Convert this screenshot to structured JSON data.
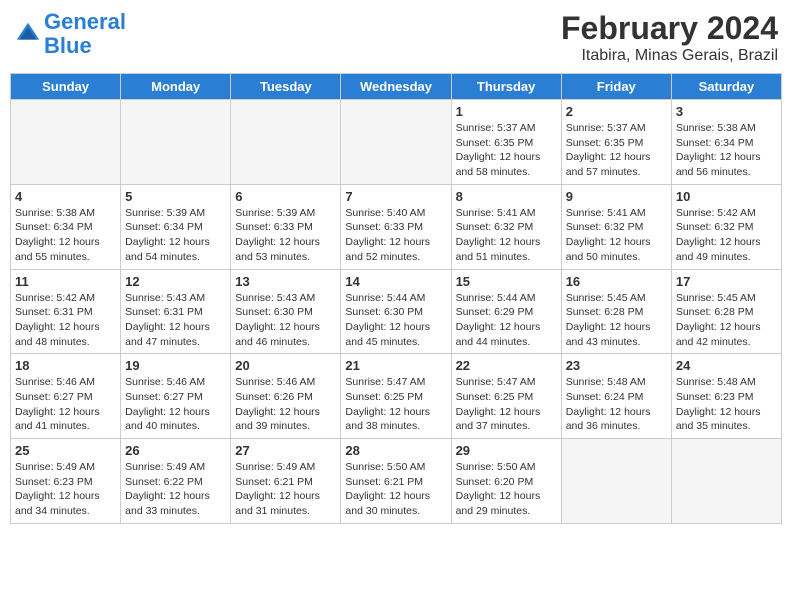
{
  "header": {
    "logo_line1": "General",
    "logo_line2": "Blue",
    "month_year": "February 2024",
    "location": "Itabira, Minas Gerais, Brazil"
  },
  "days_of_week": [
    "Sunday",
    "Monday",
    "Tuesday",
    "Wednesday",
    "Thursday",
    "Friday",
    "Saturday"
  ],
  "weeks": [
    [
      {
        "day": "",
        "empty": true
      },
      {
        "day": "",
        "empty": true
      },
      {
        "day": "",
        "empty": true
      },
      {
        "day": "",
        "empty": true
      },
      {
        "day": "1",
        "sunrise": "5:37 AM",
        "sunset": "6:35 PM",
        "daylight": "12 hours and 58 minutes."
      },
      {
        "day": "2",
        "sunrise": "5:37 AM",
        "sunset": "6:35 PM",
        "daylight": "12 hours and 57 minutes."
      },
      {
        "day": "3",
        "sunrise": "5:38 AM",
        "sunset": "6:34 PM",
        "daylight": "12 hours and 56 minutes."
      }
    ],
    [
      {
        "day": "4",
        "sunrise": "5:38 AM",
        "sunset": "6:34 PM",
        "daylight": "12 hours and 55 minutes."
      },
      {
        "day": "5",
        "sunrise": "5:39 AM",
        "sunset": "6:34 PM",
        "daylight": "12 hours and 54 minutes."
      },
      {
        "day": "6",
        "sunrise": "5:39 AM",
        "sunset": "6:33 PM",
        "daylight": "12 hours and 53 minutes."
      },
      {
        "day": "7",
        "sunrise": "5:40 AM",
        "sunset": "6:33 PM",
        "daylight": "12 hours and 52 minutes."
      },
      {
        "day": "8",
        "sunrise": "5:41 AM",
        "sunset": "6:32 PM",
        "daylight": "12 hours and 51 minutes."
      },
      {
        "day": "9",
        "sunrise": "5:41 AM",
        "sunset": "6:32 PM",
        "daylight": "12 hours and 50 minutes."
      },
      {
        "day": "10",
        "sunrise": "5:42 AM",
        "sunset": "6:32 PM",
        "daylight": "12 hours and 49 minutes."
      }
    ],
    [
      {
        "day": "11",
        "sunrise": "5:42 AM",
        "sunset": "6:31 PM",
        "daylight": "12 hours and 48 minutes."
      },
      {
        "day": "12",
        "sunrise": "5:43 AM",
        "sunset": "6:31 PM",
        "daylight": "12 hours and 47 minutes."
      },
      {
        "day": "13",
        "sunrise": "5:43 AM",
        "sunset": "6:30 PM",
        "daylight": "12 hours and 46 minutes."
      },
      {
        "day": "14",
        "sunrise": "5:44 AM",
        "sunset": "6:30 PM",
        "daylight": "12 hours and 45 minutes."
      },
      {
        "day": "15",
        "sunrise": "5:44 AM",
        "sunset": "6:29 PM",
        "daylight": "12 hours and 44 minutes."
      },
      {
        "day": "16",
        "sunrise": "5:45 AM",
        "sunset": "6:28 PM",
        "daylight": "12 hours and 43 minutes."
      },
      {
        "day": "17",
        "sunrise": "5:45 AM",
        "sunset": "6:28 PM",
        "daylight": "12 hours and 42 minutes."
      }
    ],
    [
      {
        "day": "18",
        "sunrise": "5:46 AM",
        "sunset": "6:27 PM",
        "daylight": "12 hours and 41 minutes."
      },
      {
        "day": "19",
        "sunrise": "5:46 AM",
        "sunset": "6:27 PM",
        "daylight": "12 hours and 40 minutes."
      },
      {
        "day": "20",
        "sunrise": "5:46 AM",
        "sunset": "6:26 PM",
        "daylight": "12 hours and 39 minutes."
      },
      {
        "day": "21",
        "sunrise": "5:47 AM",
        "sunset": "6:25 PM",
        "daylight": "12 hours and 38 minutes."
      },
      {
        "day": "22",
        "sunrise": "5:47 AM",
        "sunset": "6:25 PM",
        "daylight": "12 hours and 37 minutes."
      },
      {
        "day": "23",
        "sunrise": "5:48 AM",
        "sunset": "6:24 PM",
        "daylight": "12 hours and 36 minutes."
      },
      {
        "day": "24",
        "sunrise": "5:48 AM",
        "sunset": "6:23 PM",
        "daylight": "12 hours and 35 minutes."
      }
    ],
    [
      {
        "day": "25",
        "sunrise": "5:49 AM",
        "sunset": "6:23 PM",
        "daylight": "12 hours and 34 minutes."
      },
      {
        "day": "26",
        "sunrise": "5:49 AM",
        "sunset": "6:22 PM",
        "daylight": "12 hours and 33 minutes."
      },
      {
        "day": "27",
        "sunrise": "5:49 AM",
        "sunset": "6:21 PM",
        "daylight": "12 hours and 31 minutes."
      },
      {
        "day": "28",
        "sunrise": "5:50 AM",
        "sunset": "6:21 PM",
        "daylight": "12 hours and 30 minutes."
      },
      {
        "day": "29",
        "sunrise": "5:50 AM",
        "sunset": "6:20 PM",
        "daylight": "12 hours and 29 minutes."
      },
      {
        "day": "",
        "empty": true
      },
      {
        "day": "",
        "empty": true
      }
    ]
  ]
}
